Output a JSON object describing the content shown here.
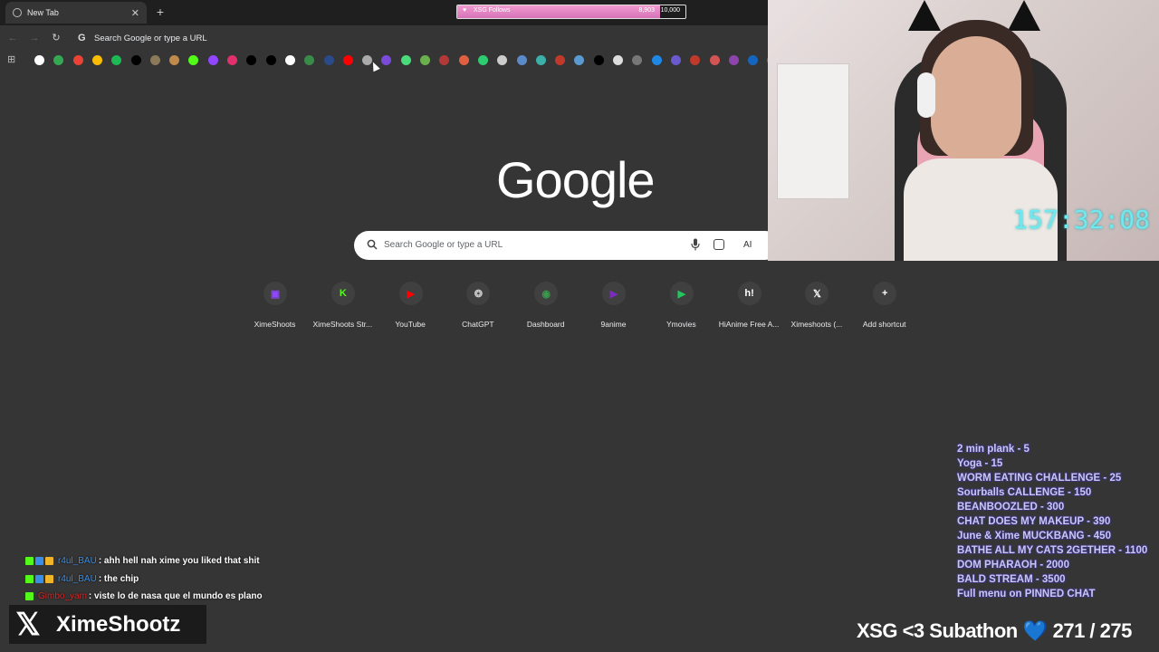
{
  "browser": {
    "tab_title": "New Tab",
    "tab_close": "✕",
    "new_tab": "+",
    "back": "←",
    "forward": "→",
    "reload": "↻",
    "omnibox_g": "G",
    "omnibox_text": "Search Google or type a URL"
  },
  "follow_goal": {
    "label": "XSG Follows",
    "current": "8,903",
    "goal": "10,000",
    "progress": 0.8903
  },
  "bookmarks": {
    "icons": [
      {
        "name": "google-icon",
        "color": "#ffffff"
      },
      {
        "name": "maps-icon",
        "color": "#34a853"
      },
      {
        "name": "gmail-icon",
        "color": "#ea4335"
      },
      {
        "name": "drive-icon",
        "color": "#fbbc04"
      },
      {
        "name": "spotify-icon",
        "color": "#1db954"
      },
      {
        "name": "x-icon",
        "color": "#000000"
      },
      {
        "name": "animal-icon",
        "color": "#8a7a5a"
      },
      {
        "name": "dog-icon",
        "color": "#c08a4a"
      },
      {
        "name": "kick-icon",
        "color": "#53fc18"
      },
      {
        "name": "twitch-icon",
        "color": "#9146ff"
      },
      {
        "name": "instagram-icon",
        "color": "#e1306c"
      },
      {
        "name": "x-icon",
        "color": "#000000"
      },
      {
        "name": "tiktok-icon",
        "color": "#000000"
      },
      {
        "name": "link-icon",
        "color": "#ffffff"
      },
      {
        "name": "dashboard-icon",
        "color": "#3a8a4a"
      },
      {
        "name": "hianime-icon",
        "color": "#2a4a8a"
      },
      {
        "name": "youtube-icon",
        "color": "#ff0000"
      },
      {
        "name": "chatgpt-icon",
        "color": "#aaaaaa"
      },
      {
        "name": "purple-icon",
        "color": "#7a4adb"
      },
      {
        "name": "leaf-icon",
        "color": "#4adb7a"
      },
      {
        "name": "plant-icon",
        "color": "#6ab04c"
      },
      {
        "name": "red-icon",
        "color": "#b33939"
      },
      {
        "name": "red2-icon",
        "color": "#e15f41"
      },
      {
        "name": "play-icon",
        "color": "#2ecc71"
      },
      {
        "name": "globe-icon",
        "color": "#cccccc"
      },
      {
        "name": "arrow-icon",
        "color": "#5a8ac8"
      },
      {
        "name": "play2-icon",
        "color": "#3ab0a8"
      },
      {
        "name": "flag-icon",
        "color": "#c0392b"
      },
      {
        "name": "box-icon",
        "color": "#5a9ad0"
      },
      {
        "name": "capcut-icon",
        "color": "#000000"
      },
      {
        "name": "circle-icon",
        "color": "#dddddd"
      },
      {
        "name": "calc-icon",
        "color": "#777777"
      },
      {
        "name": "edge-icon",
        "color": "#1e88e5"
      },
      {
        "name": "dot-icon",
        "color": "#6a5acd"
      },
      {
        "name": "heart-icon",
        "color": "#c0392b"
      },
      {
        "name": "pill-icon",
        "color": "#d35454"
      },
      {
        "name": "game-icon",
        "color": "#8e44ad"
      },
      {
        "name": "paypal-icon",
        "color": "#1565c0"
      },
      {
        "name": "facebook-icon",
        "color": "#1877f2"
      }
    ]
  },
  "newtab": {
    "logo": "Google",
    "search_placeholder": "Search Google or type a URL",
    "ai_label": "AI"
  },
  "shortcuts": [
    {
      "label": "XimeShoots",
      "glyph": "▣",
      "color": "#9146ff",
      "icon": "twitch-icon"
    },
    {
      "label": "XimeShoots Str...",
      "glyph": "K",
      "color": "#53fc18",
      "icon": "kick-icon"
    },
    {
      "label": "YouTube",
      "glyph": "▶",
      "color": "#ff0000",
      "icon": "youtube-icon"
    },
    {
      "label": "ChatGPT",
      "glyph": "❂",
      "color": "#cccccc",
      "icon": "chatgpt-icon"
    },
    {
      "label": "Dashboard",
      "glyph": "◉",
      "color": "#3a9a4a",
      "icon": "dashboard-icon"
    },
    {
      "label": "9anime",
      "glyph": "▶",
      "color": "#7b2cbf",
      "icon": "9anime-icon"
    },
    {
      "label": "Ymovies",
      "glyph": "▶",
      "color": "#22c55e",
      "icon": "ymovies-icon"
    },
    {
      "label": "HiAnime Free A...",
      "glyph": "h!",
      "color": "#ffffff",
      "icon": "hianime-icon"
    },
    {
      "label": "Ximeshoots (...",
      "glyph": "𝕏",
      "color": "#ffffff",
      "icon": "x-icon"
    },
    {
      "label": "Add shortcut",
      "glyph": "+",
      "color": "#ffffff",
      "icon": "plus-icon"
    }
  ],
  "stream": {
    "timer": "157:32:08",
    "menu": [
      "2 min plank - 5",
      "Yoga - 15",
      "WORM EATING CHALLENGE - 25",
      "Sourballs CALLENGE - 150",
      "BEANBOOZLED - 300",
      "CHAT DOES MY MAKEUP - 390",
      "June & Xime MUCKBANG - 450",
      "BATHE ALL MY CATS 2GETHER - 1100",
      "DOM PHARAOH - 2000",
      "BALD STREAM - 3500",
      "Full menu on PINNED CHAT"
    ],
    "chat": [
      {
        "user": "r4ul_BAU",
        "user_color": "#3a8ee6",
        "message": ": ahh hell nah xime you liked that shit"
      },
      {
        "user": "r4ul_BAU",
        "user_color": "#3a8ee6",
        "message": ": the chip"
      },
      {
        "user": "Gimbo_yam",
        "user_color": "#d62828",
        "message": ": viste lo de nasa que el mundo es plano"
      }
    ],
    "brand_x": "𝕏",
    "brand_name": "XimeShootz",
    "subathon_label": "XSG <3 Subathon",
    "subathon_heart": "💙",
    "subathon_count": "271 / 275"
  }
}
